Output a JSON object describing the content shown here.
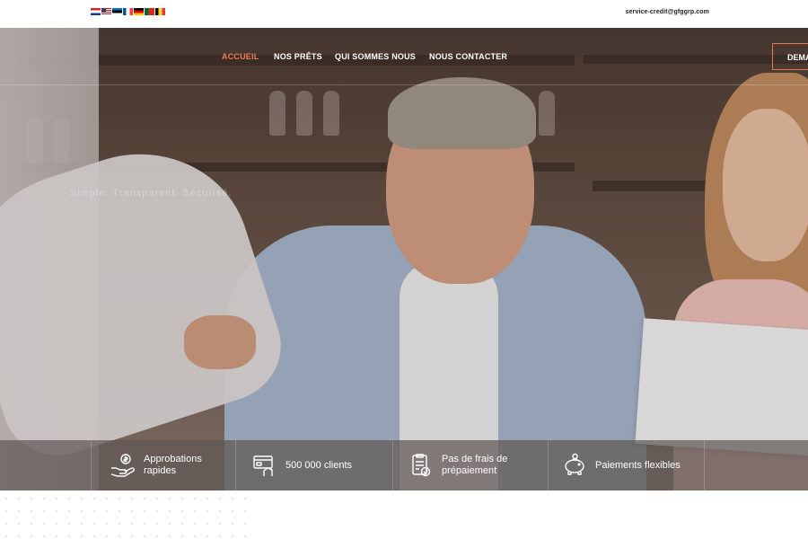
{
  "topbar": {
    "flags": [
      "flag-croatia-icon",
      "flag-usa-icon",
      "flag-estonia-icon",
      "flag-france-icon",
      "flag-germany-icon",
      "flag-portugal-icon",
      "flag-belgium-icon"
    ],
    "email": "service-credit@gfggrp.com"
  },
  "nav": {
    "items": [
      {
        "label": "ACCUEIL",
        "active": true
      },
      {
        "label": "NOS PRÊTS"
      },
      {
        "label": "QUI SOMMES NOUS"
      },
      {
        "label": "NOUS CONTACTER"
      }
    ],
    "cta_label": "DEMA"
  },
  "hero": {
    "tagline": "Simple. Transparent. Sécurisé."
  },
  "features": [
    {
      "icon": "money-hand-icon",
      "label": "Approbations rapides"
    },
    {
      "icon": "card-payment-icon",
      "label": "500 000 clients"
    },
    {
      "icon": "document-check-icon",
      "label": "Pas de frais de prépaiement"
    },
    {
      "icon": "piggy-bank-icon",
      "label": "Paiements flexibles"
    }
  ],
  "colors": {
    "accent": "#f07b57",
    "feature_bar": "#5f5855"
  }
}
